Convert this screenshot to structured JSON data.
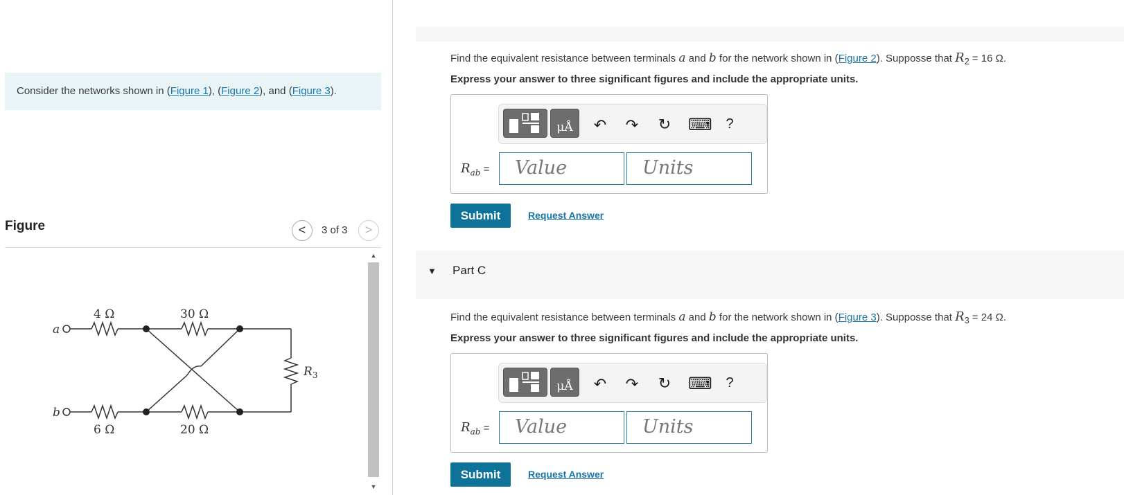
{
  "intro": {
    "prefix": "Consider the networks shown in (",
    "fig1": "Figure 1",
    "sep1": "), (",
    "fig2": "Figure 2",
    "sep2": "), and (",
    "fig3": "Figure 3",
    "suffix": ")."
  },
  "figure_panel": {
    "title": "Figure",
    "prev_icon": "<",
    "next_icon": ">",
    "count": "3 of 3",
    "scroll_up": "▲",
    "scroll_down": "▼",
    "circuit": {
      "terminal_a": "a",
      "terminal_b": "b",
      "r_top_left": "4 Ω",
      "r_top_mid": "30 Ω",
      "r_bot_left": "6 Ω",
      "r_bot_mid": "20 Ω",
      "r_right": "R",
      "r_right_sub": "3"
    }
  },
  "part_b": {
    "q_p1": "Find the equivalent resistance between terminals ",
    "q_a": "a",
    "q_p2": " and ",
    "q_b": "b",
    "q_p3": " for the network shown in (",
    "q_link": "Figure 2",
    "q_p4": "). Supposse that ",
    "q_r": "R",
    "q_rsub": "2",
    "q_p5": " = 16 Ω.",
    "instructions": "Express your answer to three significant figures and include the appropriate units.",
    "label_r": "R",
    "label_sub": "ab",
    "label_eq": " =",
    "value_placeholder": "Value",
    "units_placeholder": "Units",
    "submit": "Submit",
    "request": "Request Answer"
  },
  "part_c": {
    "caret": "▼",
    "label": "Part C",
    "q_p1": "Find the equivalent resistance between terminals ",
    "q_a": "a",
    "q_p2": " and ",
    "q_b": "b",
    "q_p3": " for the network shown in (",
    "q_link": "Figure 3",
    "q_p4": "). Supposse that ",
    "q_r": "R",
    "q_rsub": "3",
    "q_p5": " = 24 Ω.",
    "instructions": "Express your answer to three significant figures and include the appropriate units.",
    "label_r": "R",
    "label_sub": "ab",
    "label_eq": " =",
    "value_placeholder": "Value",
    "units_placeholder": "Units",
    "submit": "Submit",
    "request": "Request Answer"
  },
  "toolbar": {
    "units_glyph": "μÅ",
    "undo": "↶",
    "redo": "↷",
    "reset": "↻",
    "keyboard": "⌨",
    "help": "?"
  },
  "colors": {
    "intro_bg": "#e8f4f6",
    "submit_bg": "#0f7298",
    "link": "#1a75a8",
    "field_border": "#2a7fa6"
  },
  "icons": [
    "chevron-left-icon",
    "chevron-right-icon",
    "template-icon",
    "units-icon",
    "undo-icon",
    "redo-icon",
    "reset-icon",
    "keyboard-icon",
    "help-icon",
    "caret-down-icon"
  ]
}
